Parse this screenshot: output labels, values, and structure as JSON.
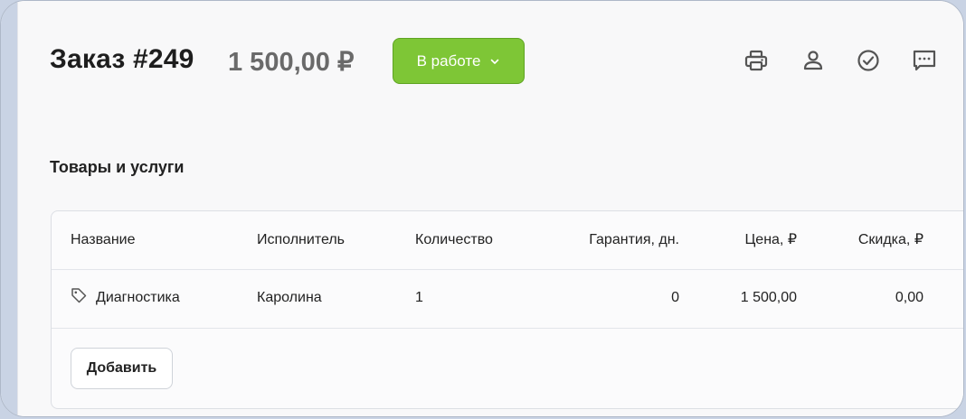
{
  "header": {
    "order_title": "Заказ #249",
    "order_sum": "1 500,00 ₽",
    "status_label": "В работе",
    "status_color": "#7ec636"
  },
  "toolbar_icons": [
    "printer-icon",
    "user-icon",
    "check-circle-icon",
    "comment-icon"
  ],
  "section": {
    "title": "Товары и услуги"
  },
  "table": {
    "columns": {
      "name": "Название",
      "performer": "Исполнитель",
      "quantity": "Количество",
      "warranty": "Гарантия, дн.",
      "price": "Цена, ₽",
      "discount": "Скидка, ₽"
    },
    "rows": [
      {
        "name": "Диагностика",
        "performer": "Каролина",
        "quantity": "1",
        "warranty": "0",
        "price": "1 500,00",
        "discount": "0,00"
      }
    ],
    "add_label": "Добавить"
  }
}
